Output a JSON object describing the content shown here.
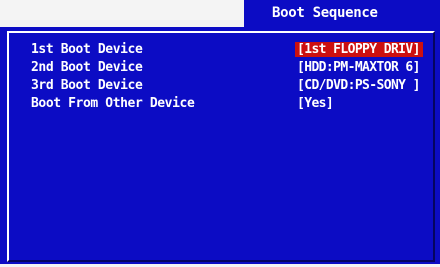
{
  "header": {
    "title": "Boot Sequence"
  },
  "boot_items": [
    {
      "label": "1st Boot Device",
      "value": "[1st FLOPPY DRIV]",
      "selected": true
    },
    {
      "label": "2nd Boot Device",
      "value": "[HDD:PM-MAXTOR 6]",
      "selected": false
    },
    {
      "label": "3rd Boot Device",
      "value": "[CD/DVD:PS-SONY ]",
      "selected": false
    },
    {
      "label": "Boot From Other Device",
      "value": "[Yes]",
      "selected": false
    }
  ],
  "colors": {
    "background": "#0c0cc4",
    "highlight": "#cc1010",
    "text": "#ffffff"
  }
}
